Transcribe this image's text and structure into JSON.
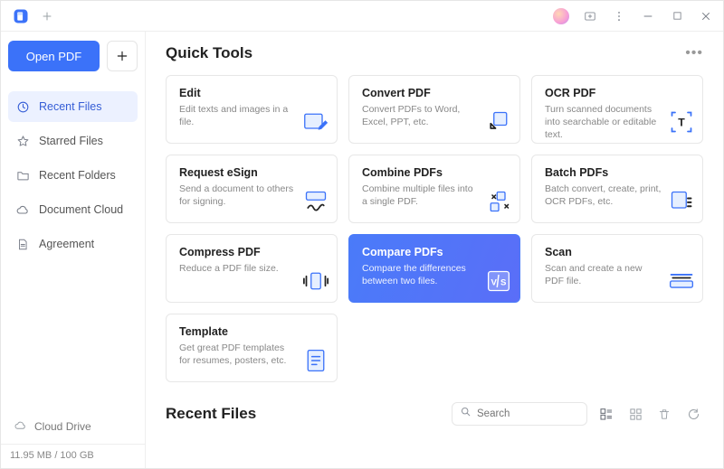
{
  "titlebar": {
    "avatar_present": true
  },
  "sidebar": {
    "open_pdf_label": "Open PDF",
    "items": [
      {
        "label": "Recent Files",
        "icon": "clock"
      },
      {
        "label": "Starred Files",
        "icon": "star"
      },
      {
        "label": "Recent Folders",
        "icon": "folder"
      },
      {
        "label": "Document Cloud",
        "icon": "cloud"
      },
      {
        "label": "Agreement",
        "icon": "document"
      }
    ],
    "cloud_drive_label": "Cloud Drive",
    "storage_text": "11.95 MB / 100 GB"
  },
  "content": {
    "quick_tools_title": "Quick Tools",
    "recent_files_title": "Recent Files",
    "search_placeholder": "Search",
    "tools": [
      {
        "title": "Edit",
        "desc": "Edit texts and images in a file.",
        "icon": "edit",
        "highlight": false
      },
      {
        "title": "Convert PDF",
        "desc": "Convert PDFs to Word, Excel, PPT, etc.",
        "icon": "convert",
        "highlight": false
      },
      {
        "title": "OCR PDF",
        "desc": "Turn scanned documents into searchable or editable text.",
        "icon": "ocr",
        "highlight": false
      },
      {
        "title": "Request eSign",
        "desc": "Send a document to others for signing.",
        "icon": "esign",
        "highlight": false
      },
      {
        "title": "Combine PDFs",
        "desc": "Combine multiple files into a single PDF.",
        "icon": "combine",
        "highlight": false
      },
      {
        "title": "Batch PDFs",
        "desc": "Batch convert, create, print, OCR PDFs, etc.",
        "icon": "batch",
        "highlight": false
      },
      {
        "title": "Compress PDF",
        "desc": "Reduce a PDF file size.",
        "icon": "compress",
        "highlight": false
      },
      {
        "title": "Compare PDFs",
        "desc": "Compare the differences between two files.",
        "icon": "compare",
        "highlight": true
      },
      {
        "title": "Scan",
        "desc": "Scan and create a new PDF file.",
        "icon": "scan",
        "highlight": false
      },
      {
        "title": "Template",
        "desc": "Get great PDF templates for resumes, posters, etc.",
        "icon": "template",
        "highlight": false
      }
    ]
  }
}
